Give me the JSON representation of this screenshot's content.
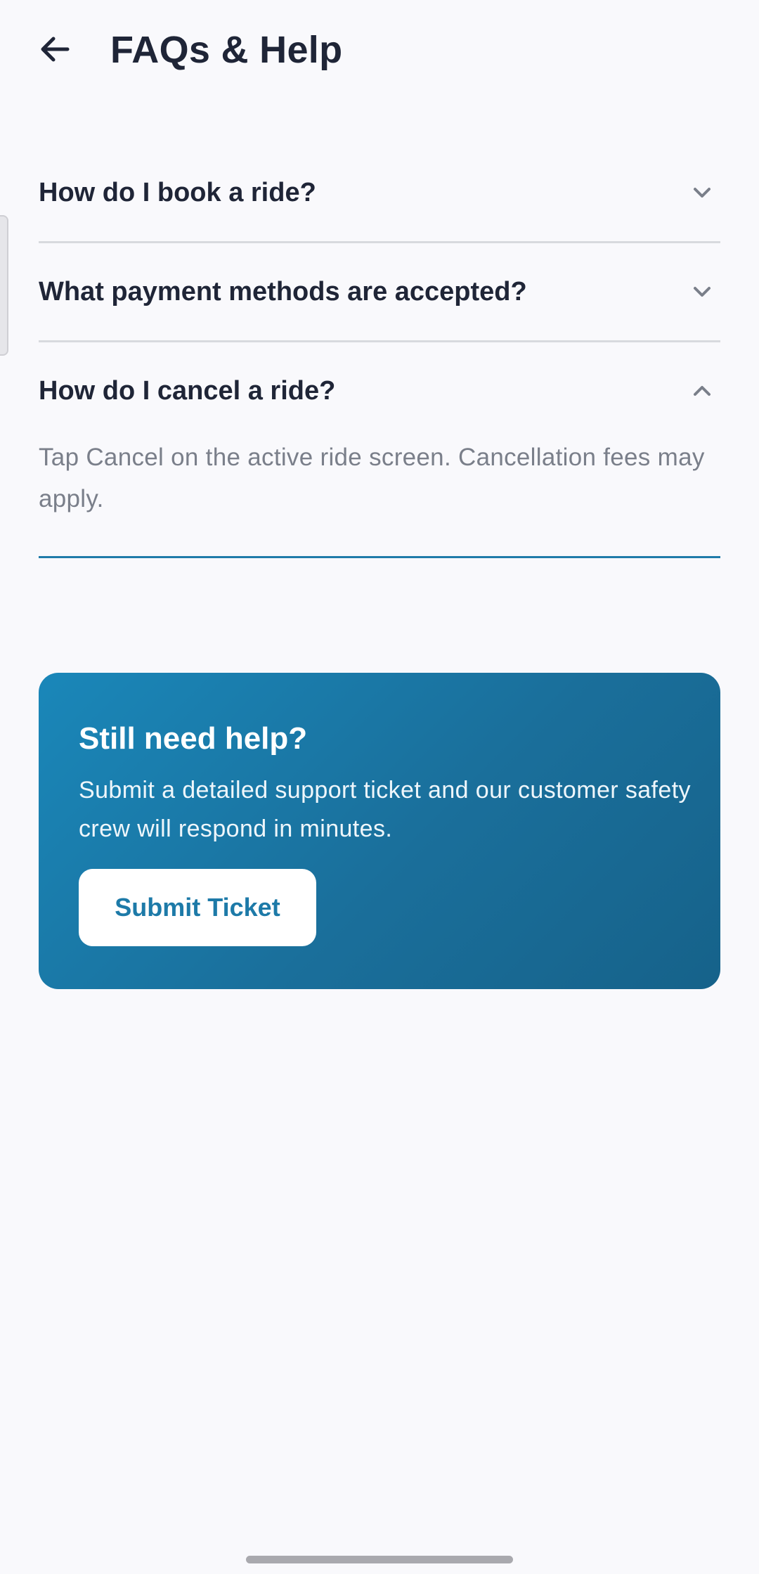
{
  "header": {
    "title": "FAQs & Help",
    "back_icon": "arrow-left-icon"
  },
  "faqs": [
    {
      "question": "How do I book a ride?",
      "expanded": false,
      "icon": "chevron-down-icon"
    },
    {
      "question": "What payment methods are accepted?",
      "expanded": false,
      "icon": "chevron-down-icon"
    },
    {
      "question": "How do I cancel a ride?",
      "expanded": true,
      "icon": "chevron-up-icon",
      "answer": "Tap Cancel on the active ride screen. Cancellation fees may apply."
    }
  ],
  "help_card": {
    "title": "Still need help?",
    "body": "Submit a detailed support ticket and our customer safety crew will respond in minutes.",
    "button_label": "Submit Ticket"
  },
  "colors": {
    "accent": "#1d7aa8",
    "text_primary": "#1f2537",
    "text_secondary": "#7a7f8a",
    "background": "#f9f9fc"
  }
}
